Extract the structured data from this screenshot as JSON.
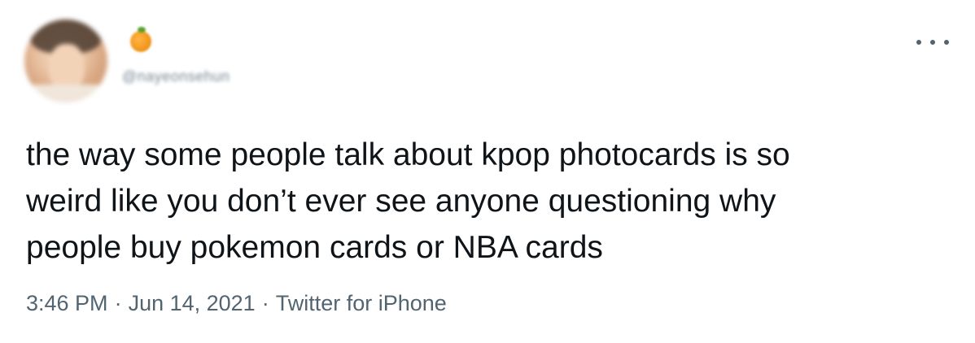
{
  "tweet": {
    "author": {
      "handle": "@nayeonsehun",
      "name_emoji": "orange-emoji"
    },
    "text": "the way some people talk about kpop photocards is so\nweird like you don’t ever see anyone questioning why\npeople buy pokemon cards or NBA cards",
    "time": "3:46 PM",
    "separator": "·",
    "date": "Jun 14, 2021",
    "source": "Twitter for iPhone"
  },
  "icons": {
    "more": "more-options-icon",
    "avatar": "avatar"
  },
  "colors": {
    "text": "#0f1419",
    "secondary": "#536471",
    "background": "#ffffff"
  }
}
